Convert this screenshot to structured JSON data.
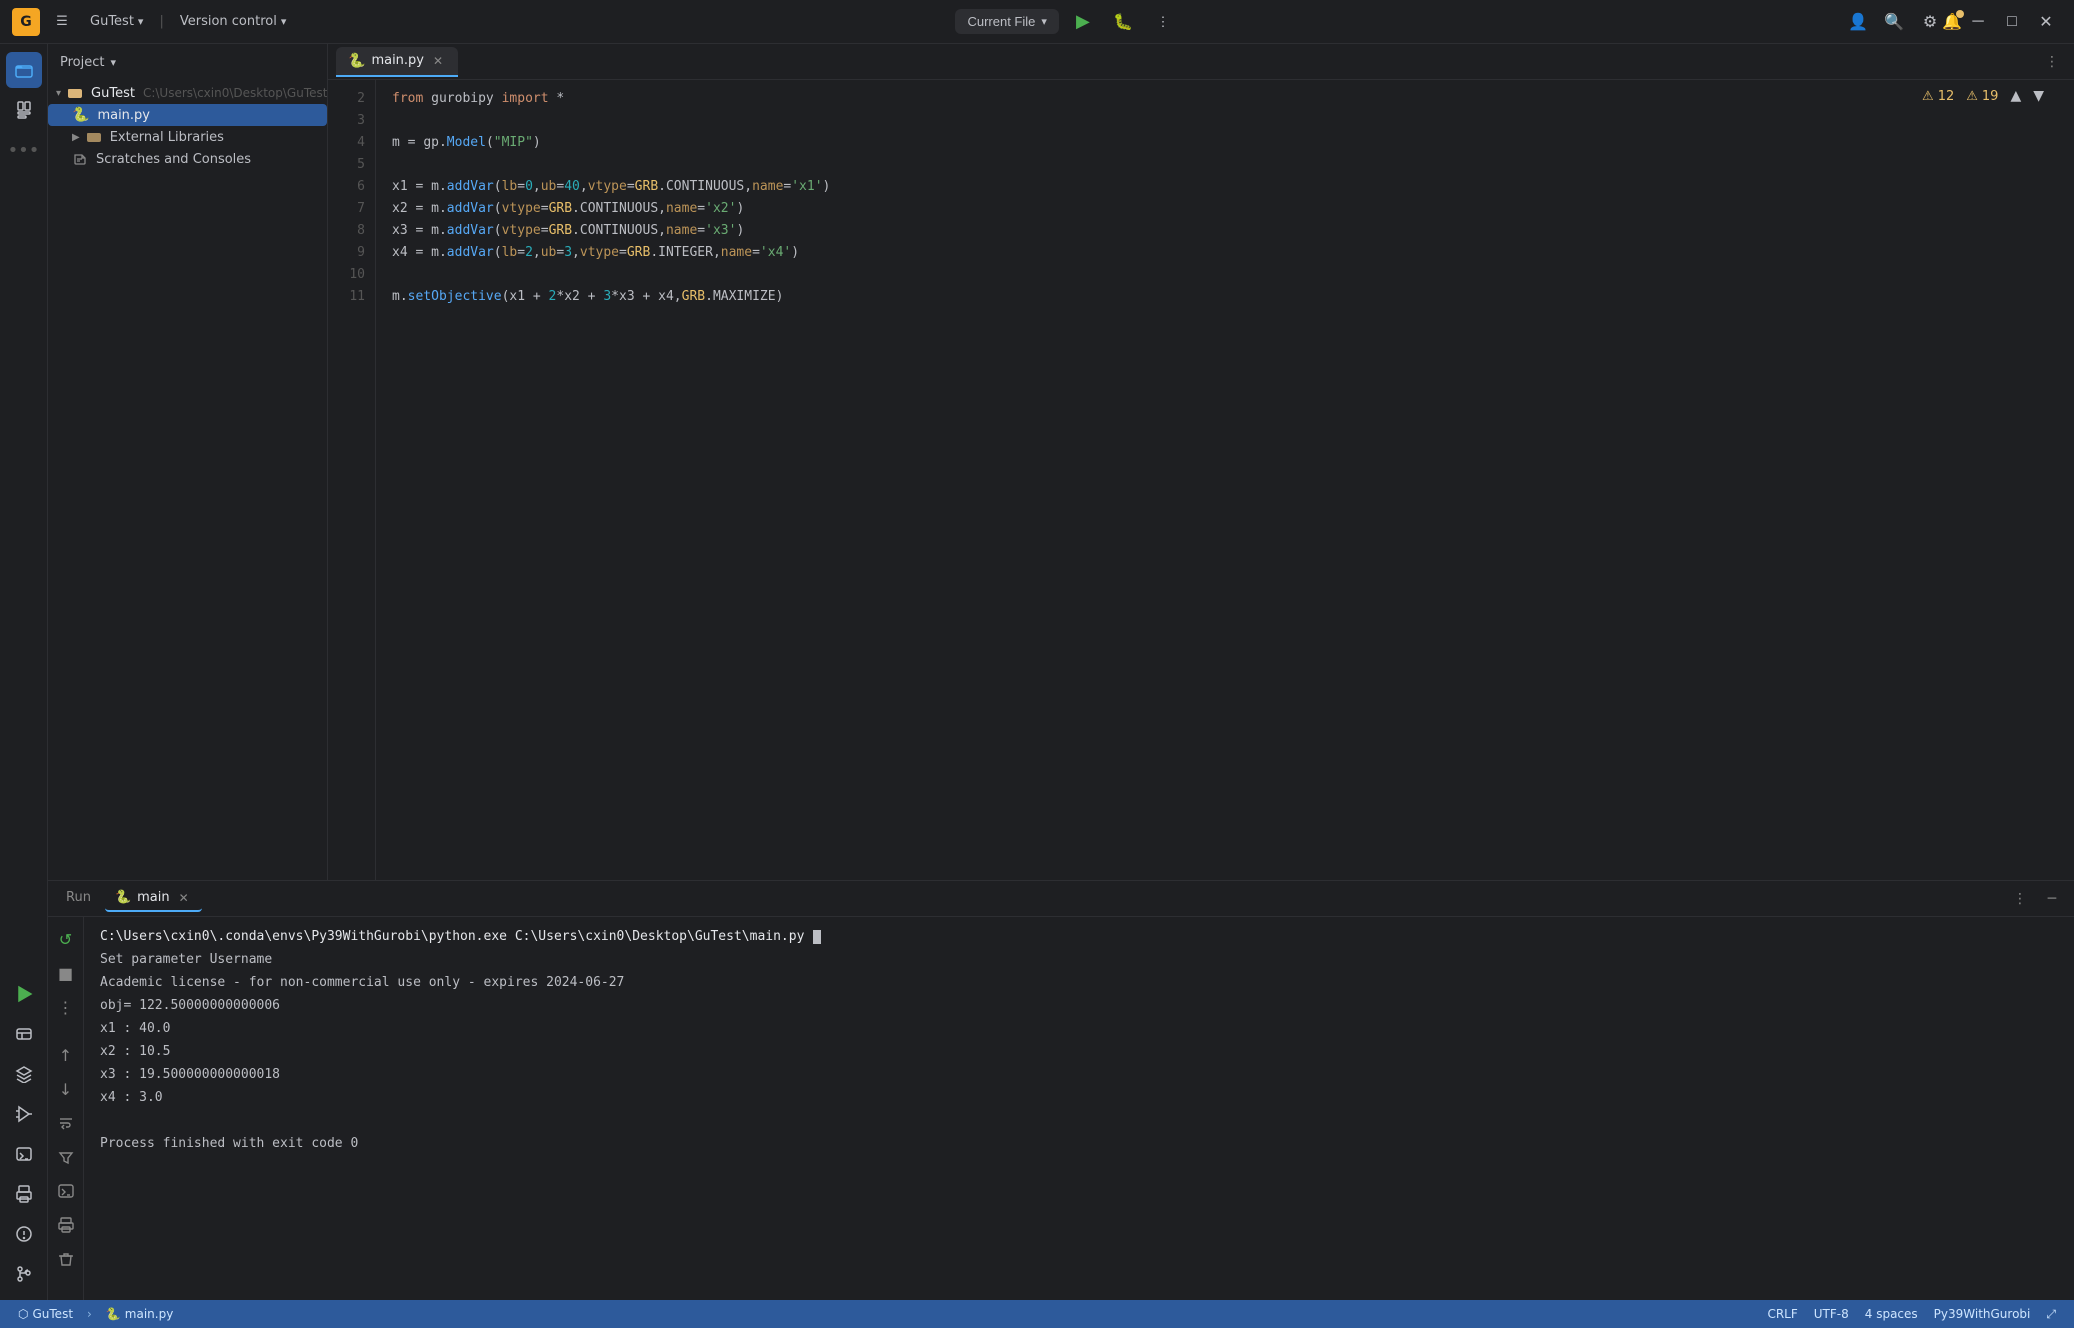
{
  "app": {
    "logo": "G",
    "title": "GuTest",
    "vcs_label": "Version control",
    "current_file_label": "Current File",
    "chevron": "▾"
  },
  "titlebar": {
    "menu_icon": "☰",
    "project_name": "GuTest",
    "vcs_label": "Version control",
    "more_icon": "⋮",
    "run_icon": "▶",
    "bug_icon": "🐞",
    "user_icon": "👤",
    "search_icon": "🔍",
    "settings_icon": "⚙",
    "minimize_icon": "─",
    "restore_icon": "□",
    "close_icon": "✕",
    "notifications_icon": "🔔",
    "add_user_icon": "👤+"
  },
  "sidebar": {
    "title": "Project",
    "chevron": "▾",
    "items": [
      {
        "label": "GuTest",
        "path": "C:\\Users\\cxin0\\Desktop\\GuTest",
        "type": "root",
        "expanded": true,
        "indent": 0
      },
      {
        "label": "main.py",
        "type": "file",
        "icon": "🐍",
        "indent": 1,
        "selected": true
      },
      {
        "label": "External Libraries",
        "type": "folder",
        "indent": 1,
        "expanded": false
      },
      {
        "label": "Scratches and Consoles",
        "type": "scratches",
        "indent": 1
      }
    ]
  },
  "editor": {
    "tab_label": "main.py",
    "tab_icon": "🐍",
    "warnings": "12",
    "errors": "19",
    "up_arrow": "▲",
    "down_arrow": "▼",
    "more_icon": "⋮",
    "lines": [
      {
        "num": 2,
        "content": "from gurobipy import *",
        "tokens": [
          {
            "text": "from ",
            "cls": "kw"
          },
          {
            "text": "gurobipy ",
            "cls": "var"
          },
          {
            "text": "import",
            "cls": "kw"
          },
          {
            "text": " *",
            "cls": "op"
          }
        ]
      },
      {
        "num": 3,
        "content": "",
        "tokens": []
      },
      {
        "num": 4,
        "content": "m = gp.Model(\"MIP\")",
        "tokens": [
          {
            "text": "m",
            "cls": "var"
          },
          {
            "text": " = ",
            "cls": "op"
          },
          {
            "text": "gp",
            "cls": "var"
          },
          {
            "text": ".",
            "cls": "op"
          },
          {
            "text": "Model",
            "cls": "fn"
          },
          {
            "text": "(",
            "cls": "op"
          },
          {
            "text": "\"MIP\"",
            "cls": "str"
          },
          {
            "text": ")",
            "cls": "op"
          }
        ]
      },
      {
        "num": 5,
        "content": "",
        "tokens": []
      },
      {
        "num": 6,
        "content": "x1 = m.addVar(lb=0,ub=40,vtype=GRB.CONTINUOUS,name='x1')",
        "tokens": [
          {
            "text": "x1",
            "cls": "var"
          },
          {
            "text": " = ",
            "cls": "op"
          },
          {
            "text": "m",
            "cls": "var"
          },
          {
            "text": ".",
            "cls": "op"
          },
          {
            "text": "addVar",
            "cls": "fn"
          },
          {
            "text": "(",
            "cls": "op"
          },
          {
            "text": "lb",
            "cls": "param"
          },
          {
            "text": "=",
            "cls": "op"
          },
          {
            "text": "0",
            "cls": "num"
          },
          {
            "text": ",",
            "cls": "op"
          },
          {
            "text": "ub",
            "cls": "param"
          },
          {
            "text": "=",
            "cls": "op"
          },
          {
            "text": "40",
            "cls": "num"
          },
          {
            "text": ",",
            "cls": "op"
          },
          {
            "text": "vtype",
            "cls": "param"
          },
          {
            "text": "=",
            "cls": "op"
          },
          {
            "text": "GRB",
            "cls": "cls"
          },
          {
            "text": ".",
            "cls": "op"
          },
          {
            "text": "CONTINUOUS",
            "cls": "var"
          },
          {
            "text": ",",
            "cls": "op"
          },
          {
            "text": "name",
            "cls": "param"
          },
          {
            "text": "=",
            "cls": "op"
          },
          {
            "text": "'x1'",
            "cls": "str"
          },
          {
            "text": ")",
            "cls": "op"
          }
        ]
      },
      {
        "num": 7,
        "content": "x2 = m.addVar(vtype=GRB.CONTINUOUS,name='x2')",
        "tokens": [
          {
            "text": "x2",
            "cls": "var"
          },
          {
            "text": " = ",
            "cls": "op"
          },
          {
            "text": "m",
            "cls": "var"
          },
          {
            "text": ".",
            "cls": "op"
          },
          {
            "text": "addVar",
            "cls": "fn"
          },
          {
            "text": "(",
            "cls": "op"
          },
          {
            "text": "vtype",
            "cls": "param"
          },
          {
            "text": "=",
            "cls": "op"
          },
          {
            "text": "GRB",
            "cls": "cls"
          },
          {
            "text": ".",
            "cls": "op"
          },
          {
            "text": "CONTINUOUS",
            "cls": "var"
          },
          {
            "text": ",",
            "cls": "op"
          },
          {
            "text": "name",
            "cls": "param"
          },
          {
            "text": "=",
            "cls": "op"
          },
          {
            "text": "'x2'",
            "cls": "str"
          },
          {
            "text": ")",
            "cls": "op"
          }
        ]
      },
      {
        "num": 8,
        "content": "x3 = m.addVar(vtype=GRB.CONTINUOUS,name='x3')",
        "tokens": [
          {
            "text": "x3",
            "cls": "var"
          },
          {
            "text": " = ",
            "cls": "op"
          },
          {
            "text": "m",
            "cls": "var"
          },
          {
            "text": ".",
            "cls": "op"
          },
          {
            "text": "addVar",
            "cls": "fn"
          },
          {
            "text": "(",
            "cls": "op"
          },
          {
            "text": "vtype",
            "cls": "param"
          },
          {
            "text": "=",
            "cls": "op"
          },
          {
            "text": "GRB",
            "cls": "cls"
          },
          {
            "text": ".",
            "cls": "op"
          },
          {
            "text": "CONTINUOUS",
            "cls": "var"
          },
          {
            "text": ",",
            "cls": "op"
          },
          {
            "text": "name",
            "cls": "param"
          },
          {
            "text": "=",
            "cls": "op"
          },
          {
            "text": "'x3'",
            "cls": "str"
          },
          {
            "text": ")",
            "cls": "op"
          }
        ]
      },
      {
        "num": 9,
        "content": "x4 = m.addVar(lb=2,ub=3,vtype=GRB.INTEGER,name='x4')",
        "tokens": [
          {
            "text": "x4",
            "cls": "var"
          },
          {
            "text": " = ",
            "cls": "op"
          },
          {
            "text": "m",
            "cls": "var"
          },
          {
            "text": ".",
            "cls": "op"
          },
          {
            "text": "addVar",
            "cls": "fn"
          },
          {
            "text": "(",
            "cls": "op"
          },
          {
            "text": "lb",
            "cls": "param"
          },
          {
            "text": "=",
            "cls": "op"
          },
          {
            "text": "2",
            "cls": "num"
          },
          {
            "text": ",",
            "cls": "op"
          },
          {
            "text": "ub",
            "cls": "param"
          },
          {
            "text": "=",
            "cls": "op"
          },
          {
            "text": "3",
            "cls": "num"
          },
          {
            "text": ",",
            "cls": "op"
          },
          {
            "text": "vtype",
            "cls": "param"
          },
          {
            "text": "=",
            "cls": "op"
          },
          {
            "text": "GRB",
            "cls": "cls"
          },
          {
            "text": ".",
            "cls": "op"
          },
          {
            "text": "INTEGER",
            "cls": "var"
          },
          {
            "text": ",",
            "cls": "op"
          },
          {
            "text": "name",
            "cls": "param"
          },
          {
            "text": "=",
            "cls": "op"
          },
          {
            "text": "'x4'",
            "cls": "str"
          },
          {
            "text": ")",
            "cls": "op"
          }
        ]
      },
      {
        "num": 10,
        "content": "",
        "tokens": []
      },
      {
        "num": 11,
        "content": "m.setObjective(x1 + 2*x2 + 3*x3 + x4,GRB.MAXIMIZE)",
        "tokens": [
          {
            "text": "m",
            "cls": "var"
          },
          {
            "text": ".",
            "cls": "op"
          },
          {
            "text": "setObjective",
            "cls": "fn"
          },
          {
            "text": "(",
            "cls": "op"
          },
          {
            "text": "x1",
            "cls": "var"
          },
          {
            "text": " + ",
            "cls": "op"
          },
          {
            "text": "2",
            "cls": "num"
          },
          {
            "text": "*",
            "cls": "op"
          },
          {
            "text": "x2",
            "cls": "var"
          },
          {
            "text": " + ",
            "cls": "op"
          },
          {
            "text": "3",
            "cls": "num"
          },
          {
            "text": "*",
            "cls": "op"
          },
          {
            "text": "x3",
            "cls": "var"
          },
          {
            "text": " + ",
            "cls": "op"
          },
          {
            "text": "x4",
            "cls": "var"
          },
          {
            "text": ",",
            "cls": "op"
          },
          {
            "text": "GRB",
            "cls": "cls"
          },
          {
            "text": ".",
            "cls": "op"
          },
          {
            "text": "MAXIMIZE",
            "cls": "var"
          },
          {
            "text": ")",
            "cls": "op"
          }
        ]
      }
    ]
  },
  "run_panel": {
    "tab_label": "Run",
    "run_label": "main",
    "tab_icon": "🐍",
    "more_icon": "⋮",
    "minimize_icon": "─",
    "restart_icon": "↺",
    "stop_icon": "■",
    "options_icon": "⋮",
    "up_icon": "↑",
    "down_icon": "↓",
    "wrap_icon": "↵",
    "filter_icon": "⇩",
    "terminal_icon": ">_",
    "print_icon": "🖨",
    "trash_icon": "🗑",
    "warn_icon": "⚠",
    "terminal_lines": [
      {
        "text": "C:\\Users\\cxin0\\.conda\\envs\\Py39WithGurobi\\python.exe C:\\Users\\cxin0\\Desktop\\GuTest\\main.py",
        "cls": "terminal-cmd"
      },
      {
        "text": "Set parameter Username",
        "cls": ""
      },
      {
        "text": "Academic license - for non-commercial use only - expires 2024-06-27",
        "cls": ""
      },
      {
        "text": "obj= 122.50000000000006",
        "cls": ""
      },
      {
        "text": "x1 : 40.0",
        "cls": ""
      },
      {
        "text": "x2 : 10.5",
        "cls": ""
      },
      {
        "text": "x3 : 19.500000000000018",
        "cls": ""
      },
      {
        "text": "x4 : 3.0",
        "cls": ""
      },
      {
        "text": "",
        "cls": ""
      },
      {
        "text": "Process finished with exit code 0",
        "cls": ""
      }
    ]
  },
  "status_bar": {
    "project_icon": "⬡",
    "project_name": "GuTest",
    "breadcrumb_arrow": ">",
    "file_icon": "🐍",
    "file_name": "main.py",
    "line_ending": "CRLF",
    "encoding": "UTF-8",
    "indent": "4 spaces",
    "interpreter": "Py39WithGurobi",
    "expand_icon": "⤢"
  }
}
